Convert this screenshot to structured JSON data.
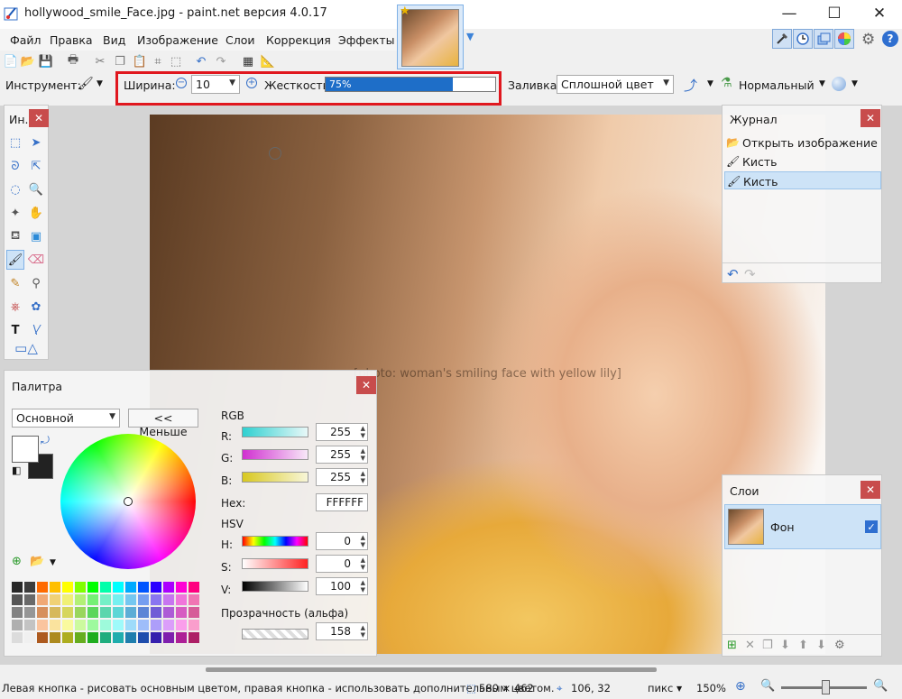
{
  "window": {
    "title": "hollywood_smile_Face.jpg - paint.net версия 4.0.17",
    "minimize": "—",
    "maximize": "☐",
    "close": "✕"
  },
  "menu": {
    "items": [
      "Файл",
      "Правка",
      "Вид",
      "Изображение",
      "Слои",
      "Коррекция",
      "Эффекты"
    ]
  },
  "options": {
    "tool_label": "Инструмент:",
    "width_label": "Ширина:",
    "width_value": "10",
    "hardness_label": "Жесткость:",
    "hardness_value": "75%",
    "hardness_fraction": 0.75,
    "fill_label": "Заливка:",
    "fill_value": "Сплошной цвет",
    "blend_value": "Нормальный"
  },
  "tools_panel": {
    "title": "Ин..."
  },
  "history_panel": {
    "title": "Журнал",
    "items": [
      "Открыть изображение",
      "Кисть",
      "Кисть"
    ]
  },
  "palette_panel": {
    "title": "Палитра",
    "mode": "Основной",
    "less_button": "<< Меньше",
    "rgb_label": "RGB",
    "r_label": "R:",
    "r_value": "255",
    "g_label": "G:",
    "g_value": "255",
    "b_label": "B:",
    "b_value": "255",
    "hex_label": "Hex:",
    "hex_value": "FFFFFF",
    "hsv_label": "HSV",
    "h_label": "H:",
    "h_value": "0",
    "s_label": "S:",
    "s_value": "0",
    "v_label": "V:",
    "v_value": "100",
    "alpha_label": "Прозрачность (альфа)",
    "alpha_value": "158"
  },
  "layers_panel": {
    "title": "Слои",
    "layer_name": "Фон"
  },
  "status": {
    "hint": "Левая кнопка - рисовать основным цветом, правая кнопка - использовать дополнительным цветом.",
    "size": "580 × 462",
    "cursor": "106, 32",
    "units": "пикс",
    "zoom": "150%"
  },
  "colors": {
    "highlight": "#e0171e",
    "accent": "#1e6ec8",
    "close": "#c84c4c"
  }
}
